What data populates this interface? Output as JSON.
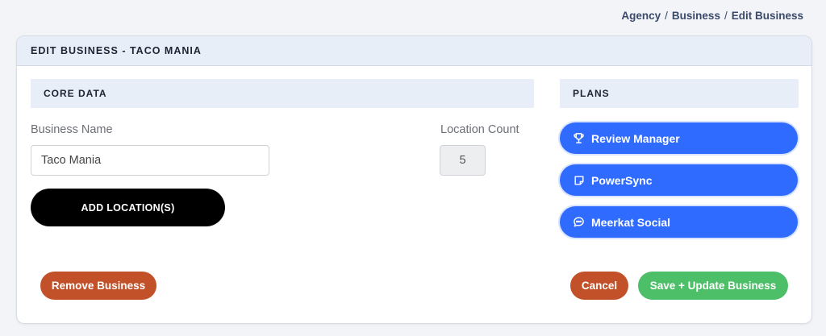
{
  "breadcrumb": {
    "items": [
      "Agency",
      "Business",
      "Edit Business"
    ],
    "separator": "/"
  },
  "card": {
    "title": "EDIT BUSINESS - TACO MANIA"
  },
  "core": {
    "section_title": "CORE DATA",
    "business_name_label": "Business Name",
    "business_name_value": "Taco Mania",
    "location_count_label": "Location Count",
    "location_count_value": "5",
    "add_location_label": "ADD LOCATION(S)"
  },
  "plans": {
    "section_title": "PLANS",
    "items": [
      {
        "label": "Review Manager",
        "icon": "trophy-icon"
      },
      {
        "label": "PowerSync",
        "icon": "note-icon"
      },
      {
        "label": "Meerkat Social",
        "icon": "chat-icon"
      }
    ]
  },
  "actions": {
    "remove_label": "Remove Business",
    "cancel_label": "Cancel",
    "save_label": "Save + Update Business"
  },
  "colors": {
    "primary_blue": "#2f6bff",
    "danger_orange": "#c2512a",
    "success_green": "#4cbf68",
    "header_bg": "#e8eef8"
  }
}
